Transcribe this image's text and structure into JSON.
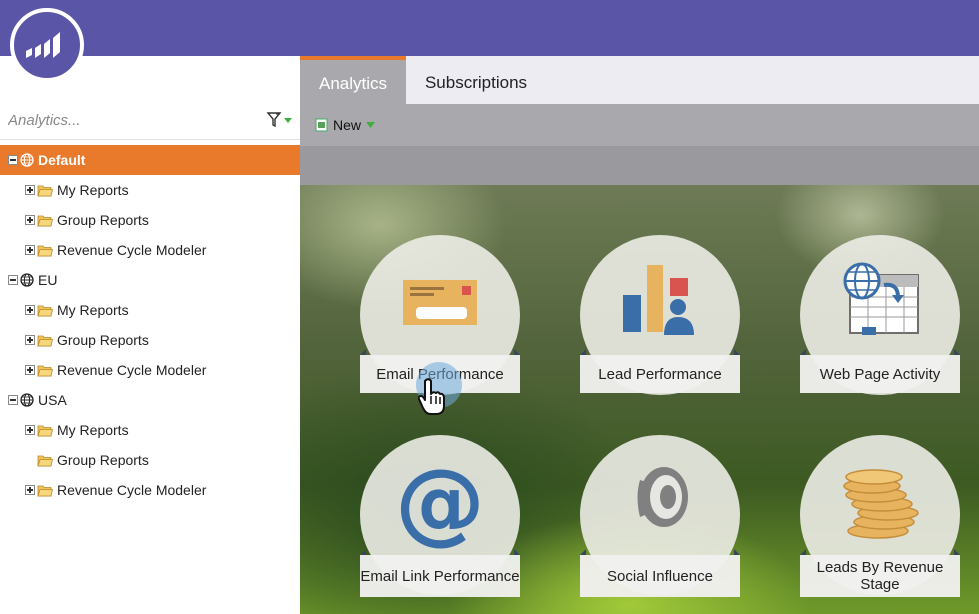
{
  "header": {
    "logo_icon": "marketo-bars-icon",
    "brand_color": "#5b55a7"
  },
  "sidebar": {
    "search_placeholder": "Analytics...",
    "tree": [
      {
        "label": "Default",
        "level": 0,
        "type": "workspace",
        "expanded": true,
        "selected": true
      },
      {
        "label": "My Reports",
        "level": 1,
        "type": "folder",
        "expander": "plus"
      },
      {
        "label": "Group Reports",
        "level": 1,
        "type": "folder",
        "expander": "plus"
      },
      {
        "label": "Revenue Cycle Modeler",
        "level": 1,
        "type": "folder",
        "expander": "plus"
      },
      {
        "label": "EU",
        "level": 0,
        "type": "workspace",
        "expanded": true
      },
      {
        "label": "My Reports",
        "level": 1,
        "type": "folder",
        "expander": "plus"
      },
      {
        "label": "Group Reports",
        "level": 1,
        "type": "folder",
        "expander": "plus"
      },
      {
        "label": "Revenue Cycle Modeler",
        "level": 1,
        "type": "folder",
        "expander": "plus"
      },
      {
        "label": "USA",
        "level": 0,
        "type": "workspace",
        "expanded": true
      },
      {
        "label": "My Reports",
        "level": 1,
        "type": "folder",
        "expander": "plus"
      },
      {
        "label": "Group Reports",
        "level": 1,
        "type": "folder",
        "expander": "none"
      },
      {
        "label": "Revenue Cycle Modeler",
        "level": 1,
        "type": "folder",
        "expander": "plus"
      }
    ]
  },
  "tabs": {
    "analytics": "Analytics",
    "subscriptions": "Subscriptions"
  },
  "toolbar": {
    "new_label": "New"
  },
  "tiles": {
    "email_performance": {
      "label": "Email Performance",
      "icon": "envelope-icon"
    },
    "lead_performance": {
      "label": "Lead Performance",
      "icon": "bar-chart-person-icon"
    },
    "web_page_activity": {
      "label": "Web Page Activity",
      "icon": "globe-web-page-icon"
    },
    "email_link_performance": {
      "label": "Email Link Performance",
      "icon": "at-sign-icon"
    },
    "social_influence": {
      "label": "Social Influence",
      "icon": "speaker-icon"
    },
    "leads_by_revenue_stage": {
      "label": "Leads By Revenue Stage",
      "icon": "coin-stack-icon"
    }
  },
  "colors": {
    "accent": "#ea7a2b",
    "tab_active_bg": "#a9a9ad"
  }
}
